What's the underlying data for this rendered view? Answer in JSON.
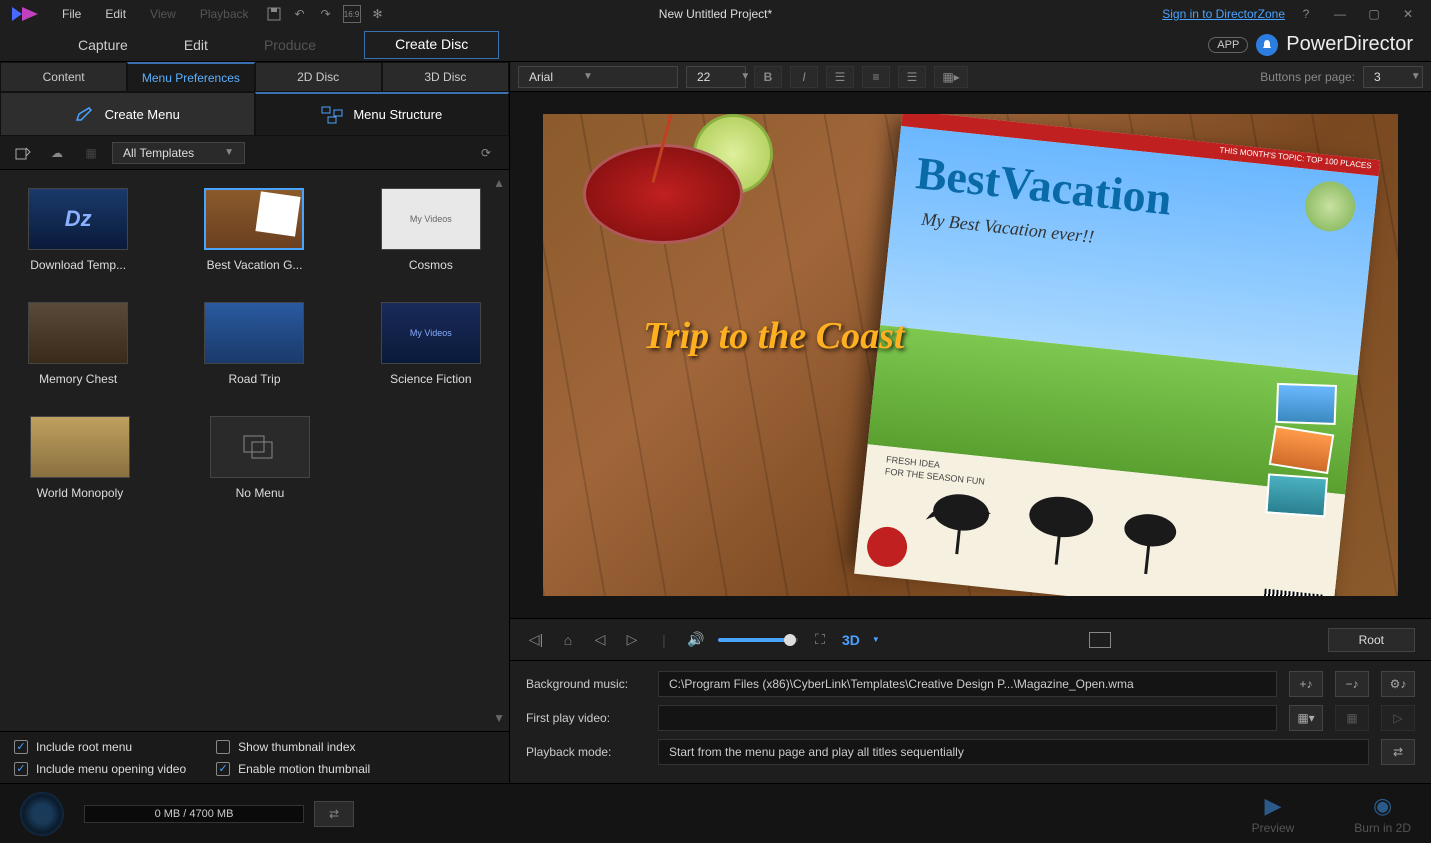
{
  "menubar": {
    "items": [
      "File",
      "Edit",
      "View",
      "Playback"
    ],
    "dim_items": [
      2,
      3
    ],
    "title": "New Untitled Project*",
    "signin_link": "Sign in to DirectorZone"
  },
  "modes": {
    "tabs": [
      "Capture",
      "Edit",
      "Produce",
      "Create Disc"
    ],
    "active": 3,
    "app_pill": "APP",
    "brand": "PowerDirector"
  },
  "subtabs": {
    "items": [
      "Content",
      "Menu Preferences",
      "2D Disc",
      "3D Disc"
    ],
    "active": 1
  },
  "create_buttons": {
    "create_menu": "Create Menu",
    "menu_structure": "Menu Structure"
  },
  "filter": {
    "dropdown": "All Templates"
  },
  "templates": [
    {
      "label": "Download Temp...",
      "style": "dz"
    },
    {
      "label": "Best Vacation G...",
      "style": "vacation",
      "selected": true
    },
    {
      "label": "Cosmos",
      "style": "cosmos"
    },
    {
      "label": "Memory Chest",
      "style": "memory"
    },
    {
      "label": "Road Trip",
      "style": "road"
    },
    {
      "label": "Science Fiction",
      "style": "scifi"
    },
    {
      "label": "World Monopoly",
      "style": "monopoly"
    },
    {
      "label": "No Menu",
      "style": "nomenu"
    }
  ],
  "options": {
    "root_menu": "Include root menu",
    "opening_video": "Include menu opening video",
    "thumb_index": "Show thumbnail index",
    "motion_thumb": "Enable motion thumbnail"
  },
  "text_toolbar": {
    "font": "Arial",
    "size": "22",
    "buttons_label": "Buttons per page:",
    "buttons_count": "3"
  },
  "preview": {
    "magazine_banner": "THIS MONTH'S TOPIC: TOP 100 PLACES",
    "magazine_title": "BestVacation",
    "magazine_sub": "My Best Vacation ever!!",
    "trip_title": "Trip to the Coast",
    "fresh": "FRESH IDEA",
    "season": "FOR THE SEASON FUN"
  },
  "playback": {
    "threed": "3D",
    "root_btn": "Root"
  },
  "settings": {
    "bg_music_label": "Background music:",
    "bg_music_value": "C:\\Program Files (x86)\\CyberLink\\Templates\\Creative Design P...\\Magazine_Open.wma",
    "first_play_label": "First play video:",
    "first_play_value": "",
    "playback_mode_label": "Playback mode:",
    "playback_mode_value": "Start from the menu page and play all titles sequentially"
  },
  "bottom": {
    "progress": "0 MB / 4700 MB",
    "preview": "Preview",
    "burn": "Burn in 2D"
  }
}
